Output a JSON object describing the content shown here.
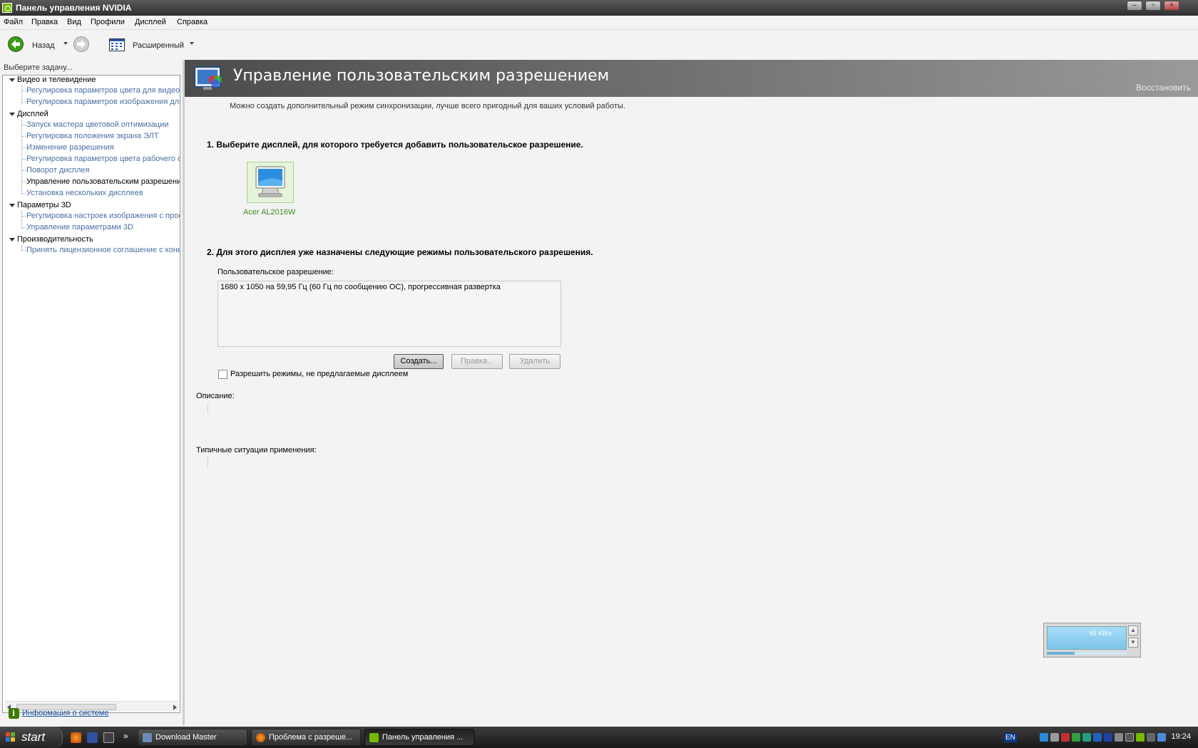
{
  "window": {
    "title": "Панель управления NVIDIA"
  },
  "window_controls": {
    "minimize": "‒",
    "maximize": "▫",
    "close": "×"
  },
  "menu": [
    "Файл",
    "Правка",
    "Вид",
    "Профили",
    "Дисплей",
    "Справка"
  ],
  "toolbar": {
    "back_label": "Назад",
    "view_label": "Расширенный"
  },
  "left_panel": {
    "task_label": "Выберите задачу...",
    "tree": [
      {
        "label": "Видео и телевидение",
        "children": [
          "Регулировка параметров цвета для видео",
          "Регулировка параметров изображения для видео"
        ]
      },
      {
        "label": "Дисплей",
        "children": [
          "Запуск мастера цветовой оптимизации",
          "Регулировка положения экрана ЭЛТ",
          "Изменение разрешения",
          "Регулировка параметров цвета рабочего стола",
          "Поворот дисплея",
          "Управление пользовательским разрешением",
          "Установка нескольких дисплеев"
        ]
      },
      {
        "label": "Параметры 3D",
        "children": [
          "Регулировка настроек изображения с просмотром",
          "Управление параметрами 3D"
        ]
      },
      {
        "label": "Производительность",
        "children": [
          "Принять лицензионное соглашение с конечным пользователем"
        ]
      }
    ],
    "selected": "Управление пользовательским разрешением",
    "system_info_link": "Информация о системе"
  },
  "main": {
    "title": "Управление пользовательским разрешением",
    "restore": "Восстановить",
    "intro": "Можно создать дополнительный режим синхронизации, лучше всего пригодный для ваших условий работы.",
    "step1": "1. Выберите дисплей, для которого требуется добавить пользовательское разрешение.",
    "display_name": "Acer AL2016W",
    "step2": "2. Для этого дисплея уже назначены следующие режимы пользовательского разрешения.",
    "custom_res_label": "Пользовательское разрешение:",
    "custom_res_items": [
      "1680 x 1050 на 59,95 Гц (60 Гц по сообщению ОС), прогрессивная развертка"
    ],
    "buttons": {
      "create": "Создать...",
      "edit": "Правка...",
      "delete": "Удалить"
    },
    "checkbox_label": "Разрешить режимы, не предлагаемые дисплеем",
    "checkbox_checked": false,
    "description_label": "Описание:",
    "typical_label": "Типичные ситуации применения:"
  },
  "speed_widget": {
    "rate": "95 KB/s",
    "progress": 0.35
  },
  "taskbar": {
    "start_label": "start",
    "items": [
      {
        "label": "Download Master",
        "active": false
      },
      {
        "label": "Проблема с разреше...",
        "active": false
      },
      {
        "label": "Панель управления ...",
        "active": true
      }
    ],
    "overflow": "»",
    "lang": "EN",
    "clock": "19:24"
  },
  "colors": {
    "nvidia_green": "#76b900",
    "link_blue": "#4a6fa5",
    "banner_dark": "#4c4c4c"
  },
  "icons": [
    "back-arrow-icon",
    "forward-arrow-icon",
    "view-grid-icon",
    "display-monitor-icon",
    "system-info-icon",
    "windows-flag-icon"
  ]
}
